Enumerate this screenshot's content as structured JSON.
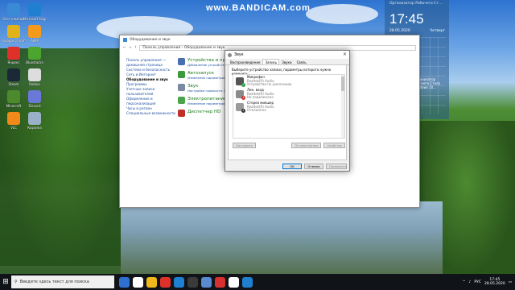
{
  "desktop": {
    "bandicam_url": "www.BANDICAM.com",
    "icons": [
      {
        "label": "Этот компьютер",
        "color": "#3b8ad6"
      },
      {
        "label": "Microsoft Edge",
        "color": "#1f7fd0"
      },
      {
        "label": "Google Chrome",
        "color": "#e2b21b"
      },
      {
        "label": "AIMP",
        "color": "#f59a1b"
      },
      {
        "label": "Яндекс",
        "color": "#e0302a"
      },
      {
        "label": "Bluestacks",
        "color": "#4ca52f"
      },
      {
        "label": "Steam",
        "color": "#1b2838"
      },
      {
        "label": "Roblox",
        "color": "#dddddd"
      },
      {
        "label": "Minecraft",
        "color": "#4d8a2e"
      },
      {
        "label": "Discord",
        "color": "#6a78d8"
      },
      {
        "label": "VLC",
        "color": "#f08a1b"
      },
      {
        "label": "Корзина",
        "color": "#9ab0c8"
      }
    ]
  },
  "clock_panel": {
    "note": "Организатор Рабочего Ст...",
    "time": "17:45",
    "date": "28.05.2020",
    "day": "Четверг",
    "note2": "Организатор Рабочего Стола Windows 10..."
  },
  "control_panel": {
    "title": "Оборудование и звук",
    "path": "Панель управления › Оборудование и звук",
    "sidebar": [
      {
        "label": "Панель управления — домашняя страница",
        "current": false
      },
      {
        "label": "Система и безопасность",
        "current": false
      },
      {
        "label": "Сеть и Интернет",
        "current": false
      },
      {
        "label": "Оборудование и звук",
        "current": true
      },
      {
        "label": "Программы",
        "current": false
      },
      {
        "label": "Учетные записи пользователей",
        "current": false
      },
      {
        "label": "Оформление и персонализация",
        "current": false
      },
      {
        "label": "Часы и регион",
        "current": false
      },
      {
        "label": "Специальные возможности",
        "current": false
      }
    ],
    "categories": [
      {
        "title": "Устройства и принтеры",
        "sub": "Добавление устройства | Дополнительные параметры",
        "color": "#4a6fb0"
      },
      {
        "title": "Автозапуск",
        "sub": "Изменение параметров по умолчанию",
        "color": "#3c9a3c"
      },
      {
        "title": "Звук",
        "sub": "Настройка громкости | Изменение звуков",
        "color": "#7a8aa0"
      },
      {
        "title": "Электропитание",
        "sub": "Изменение параметров энергосбережения",
        "color": "#4aa54a"
      },
      {
        "title": "Диспетчер HD",
        "sub": "",
        "color": "#c0302a"
      }
    ]
  },
  "sound_dialog": {
    "title": "Звук",
    "tabs": [
      "Воспроизведение",
      "Запись",
      "Звуки",
      "Связь"
    ],
    "active_tab": "Запись",
    "hint": "Выберите устройство записи, параметры которого нужно изменить:",
    "devices": [
      {
        "name": "Микрофон",
        "sub1": "Realtek(R) Audio",
        "sub2": "Устройство по умолчанию",
        "color": "#555555",
        "badge": "✓",
        "badge_color": "#2ea043"
      },
      {
        "name": "Лин. вход",
        "sub1": "Realtek(R) Audio",
        "sub2": "Не подключено",
        "color": "#8a8a8a",
        "badge": "↓",
        "badge_color": "#d03030"
      },
      {
        "name": "Стерео микшер",
        "sub1": "Realtek(R) Audio",
        "sub2": "Отключено",
        "color": "#9a9a9a",
        "badge": "↓",
        "badge_color": "#333333"
      }
    ],
    "buttons": {
      "configure": "Настроить",
      "set_default": "По умолчанию",
      "properties": "Свойства",
      "ok": "ОК",
      "cancel": "Отмена",
      "apply": "Применить"
    }
  },
  "taskbar": {
    "search_placeholder": "Введите здесь текст для поиска",
    "apps": [
      "#2f6fd0",
      "#ffffff",
      "#f0b81b",
      "#e0302a",
      "#1f7fd0",
      "#3a3a3a",
      "#5a8ad0",
      "#d83030",
      "#ffffff",
      "#1f7fd0"
    ],
    "lang": "РУС",
    "time": "17:45",
    "date": "28.05.2020"
  }
}
